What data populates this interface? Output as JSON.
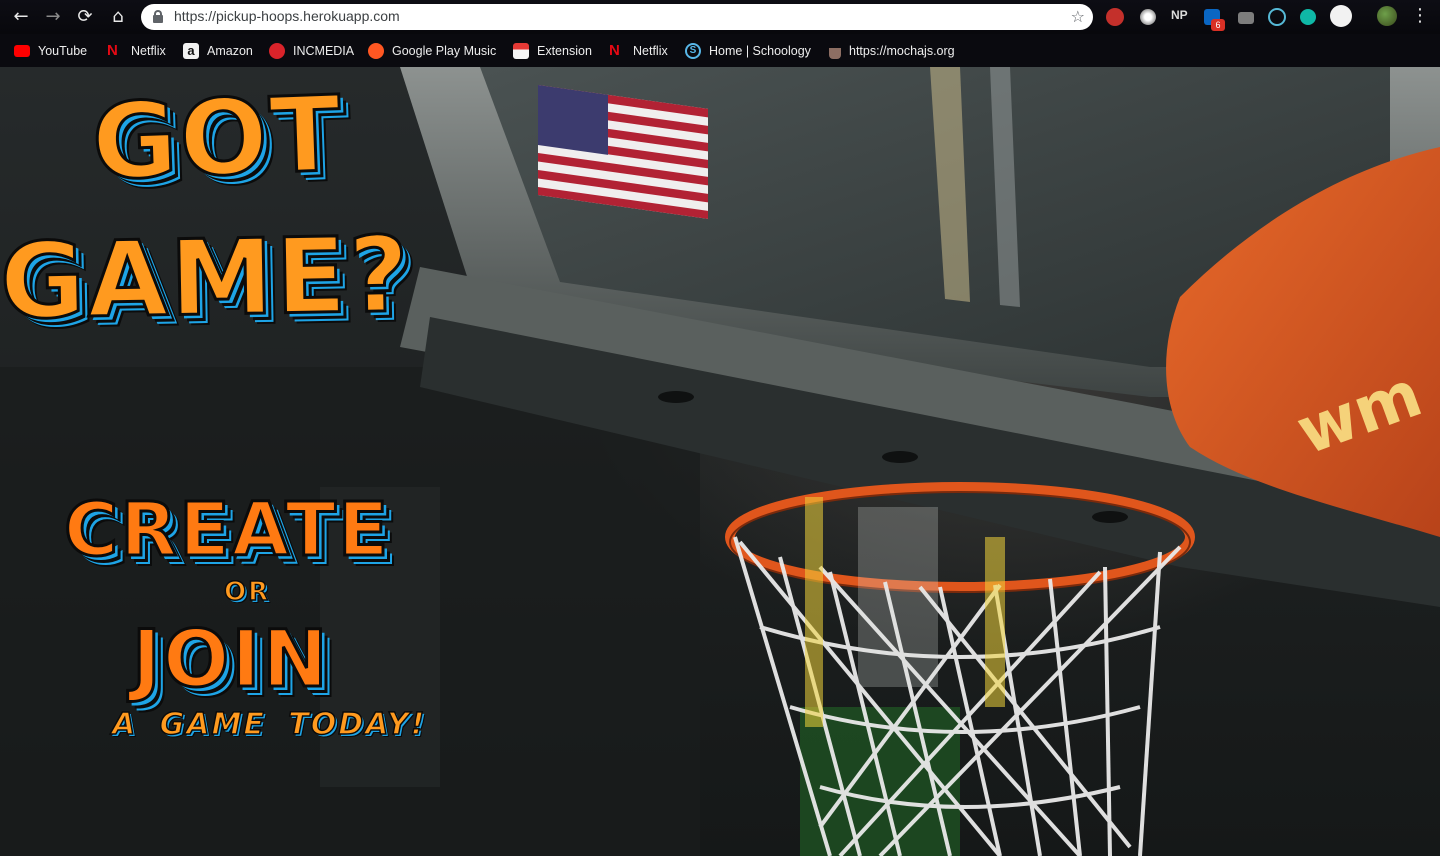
{
  "browser": {
    "url": "https://pickup-hoops.herokuapp.com",
    "badge_count": "6",
    "extensions": {
      "np_label": "NP"
    },
    "bookmarks": [
      {
        "label": "YouTube",
        "icon": "youtube-icon"
      },
      {
        "label": "Netflix",
        "icon": "netflix-icon"
      },
      {
        "label": "Amazon",
        "icon": "amazon-icon"
      },
      {
        "label": "INCMEDIA",
        "icon": "incmedia-icon"
      },
      {
        "label": "Google Play Music",
        "icon": "play-music-icon"
      },
      {
        "label": "Extension",
        "icon": "extension-icon"
      },
      {
        "label": "Netflix",
        "icon": "netflix-icon"
      },
      {
        "label": "Home | Schoology",
        "icon": "schoology-icon"
      },
      {
        "label": "https://mochajs.org",
        "icon": "mocha-icon"
      }
    ]
  },
  "hero": {
    "line1": "GOT",
    "line2": "GAME?",
    "create": "CREATE",
    "or": "OR",
    "join": "JOIN",
    "tagline": "A GAME TODAY!"
  },
  "background": {
    "backboard_brand": "wm",
    "colors": {
      "accent_orange": "#ff9a1f",
      "accent_blue": "#1ea4e6",
      "rim": "#e0561c"
    }
  }
}
